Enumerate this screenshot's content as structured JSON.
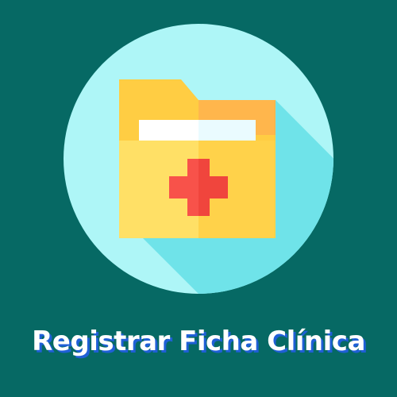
{
  "tile": {
    "label": "Registrar Ficha Clínica",
    "icon": "medical-folder-icon",
    "colors": {
      "background": "#066964",
      "circle": "#aef6f7",
      "shadow": "#6fe3e9",
      "folder_front": "#ffd85a",
      "folder_back": "#ffcd43",
      "folder_tab_right": "#ffb64c",
      "paper": "#ffffff",
      "cross": "#f8524a",
      "text_shadow": "#1f5fd6"
    }
  }
}
